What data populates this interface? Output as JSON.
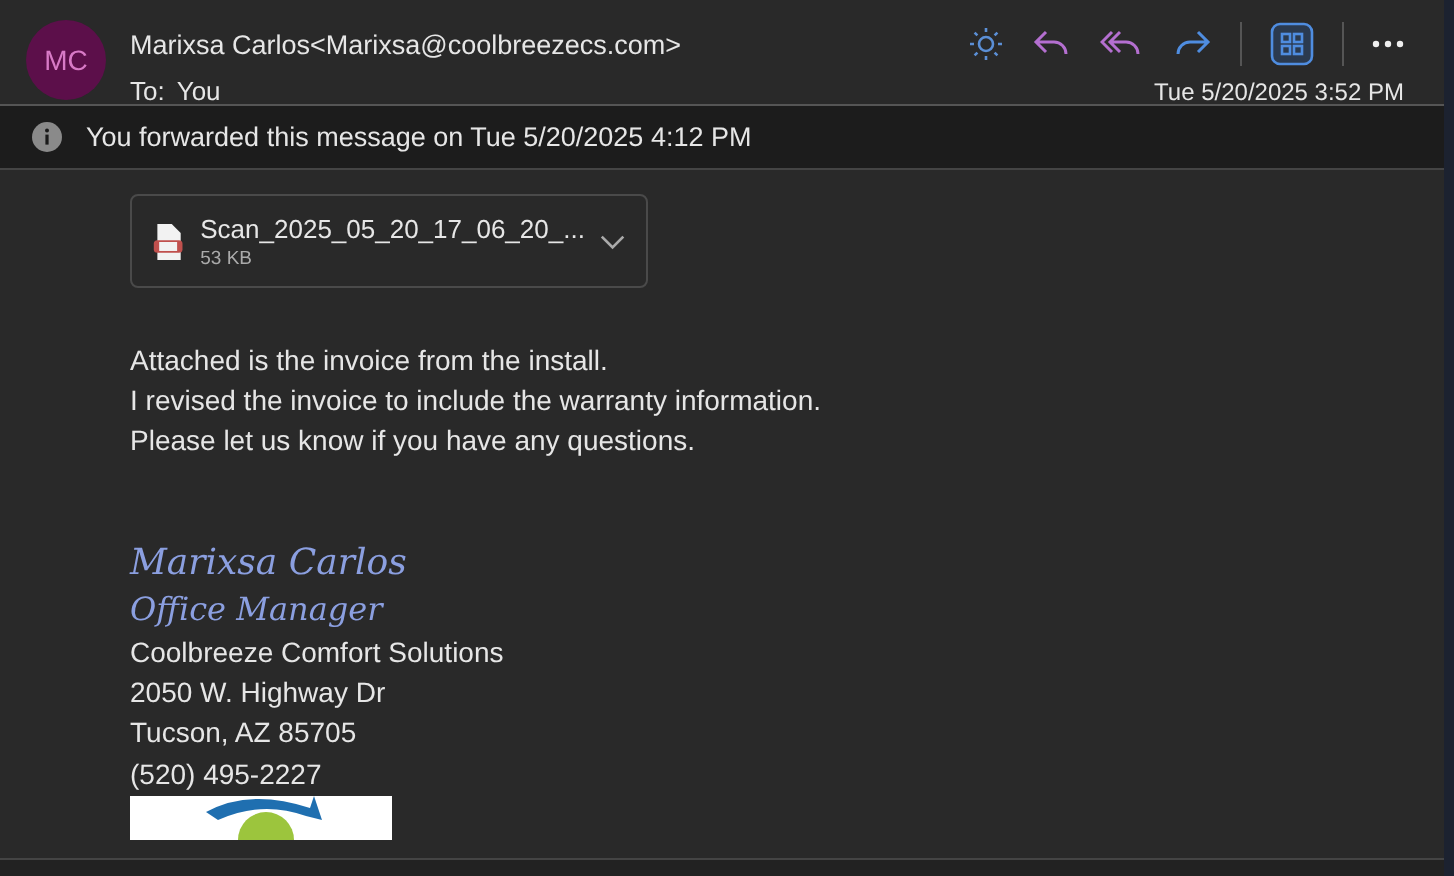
{
  "sender": {
    "initials": "MC",
    "name": "Marixsa Carlos",
    "email": "<Marixsa@coolbreezecs.com>"
  },
  "recipient": {
    "label": "To:",
    "name": "You"
  },
  "date": "Tue 5/20/2025 3:52 PM",
  "banner": "You forwarded this message on Tue 5/20/2025 4:12 PM",
  "attachment": {
    "name": "Scan_2025_05_20_17_06_20_...",
    "size": "53 KB"
  },
  "body": [
    "Attached is the invoice from the install.",
    "I revised the invoice to include the warranty information.",
    "Please let us know if you have any questions."
  ],
  "signature": {
    "name": "Marixsa Carlos",
    "title": "Office Manager",
    "lines": [
      "Coolbreeze Comfort Solutions",
      "2050 W. Highway Dr",
      "Tucson, AZ 85705"
    ],
    "phone": "(520) 495-2227"
  }
}
